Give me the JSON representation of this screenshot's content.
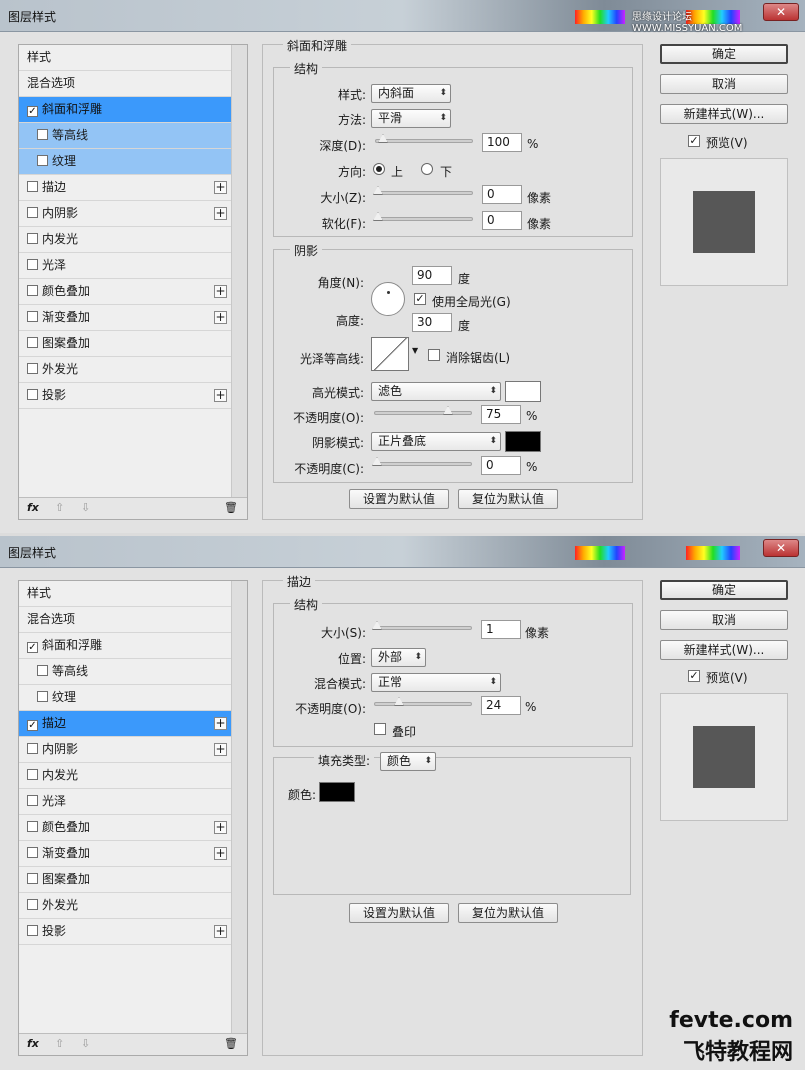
{
  "window": {
    "title": "图层样式",
    "site": "思缘设计论坛 WWW.MISSYUAN.COM",
    "close": "✕"
  },
  "sidebar": {
    "items": [
      {
        "label": "样式"
      },
      {
        "label": "混合选项"
      },
      {
        "label": "斜面和浮雕"
      },
      {
        "label": "等高线"
      },
      {
        "label": "纹理"
      },
      {
        "label": "描边"
      },
      {
        "label": "内阴影"
      },
      {
        "label": "内发光"
      },
      {
        "label": "光泽"
      },
      {
        "label": "颜色叠加"
      },
      {
        "label": "渐变叠加"
      },
      {
        "label": "图案叠加"
      },
      {
        "label": "外发光"
      },
      {
        "label": "投影"
      }
    ],
    "footer": {
      "fx": "fx",
      "up": "⇧",
      "down": "⇩",
      "trash": "🗑"
    }
  },
  "buttons": {
    "ok": "确定",
    "cancel": "取消",
    "new_style": "新建样式(W)...",
    "preview": "预览(V)",
    "set_default": "设置为默认值",
    "reset_default": "复位为默认值"
  },
  "panel1": {
    "section": "斜面和浮雕",
    "structure": {
      "heading": "结构",
      "style_label": "样式:",
      "style_value": "内斜面",
      "technique_label": "方法:",
      "technique_value": "平滑",
      "depth_label": "深度(D):",
      "depth_value": "100",
      "depth_unit": "%",
      "direction_label": "方向:",
      "up": "上",
      "down": "下",
      "size_label": "大小(Z):",
      "size_value": "0",
      "size_unit": "像素",
      "soften_label": "软化(F):",
      "soften_value": "0",
      "soften_unit": "像素"
    },
    "shading": {
      "heading": "阴影",
      "angle_label": "角度(N):",
      "angle_value": "90",
      "angle_unit": "度",
      "global_light": "使用全局光(G)",
      "altitude_label": "高度:",
      "altitude_value": "30",
      "altitude_unit": "度",
      "gloss_label": "光泽等高线:",
      "anti_alias": "消除锯齿(L)",
      "highlight_label": "高光模式:",
      "highlight_value": "滤色",
      "highlight_color": "#ffffff",
      "highlight_opacity_label": "不透明度(O):",
      "highlight_opacity_value": "75",
      "highlight_opacity_unit": "%",
      "shadow_label": "阴影模式:",
      "shadow_value": "正片叠底",
      "shadow_color": "#000000",
      "shadow_opacity_label": "不透明度(C):",
      "shadow_opacity_value": "0",
      "shadow_opacity_unit": "%"
    }
  },
  "panel2": {
    "section": "描边",
    "structure": {
      "heading": "结构",
      "size_label": "大小(S):",
      "size_value": "1",
      "size_unit": "像素",
      "position_label": "位置:",
      "position_value": "外部",
      "blend_label": "混合模式:",
      "blend_value": "正常",
      "opacity_label": "不透明度(O):",
      "opacity_value": "24",
      "opacity_unit": "%",
      "overprint": "叠印"
    },
    "fill": {
      "type_label": "填充类型:",
      "type_value": "颜色",
      "color_label": "颜色:",
      "color": "#000000"
    }
  },
  "watermark": {
    "line1": "fevte.com",
    "line2": "飞特教程网"
  },
  "colors": {
    "selected": "#3b99fb",
    "sublight": "#93c4f5",
    "preview_square": "#575757"
  }
}
